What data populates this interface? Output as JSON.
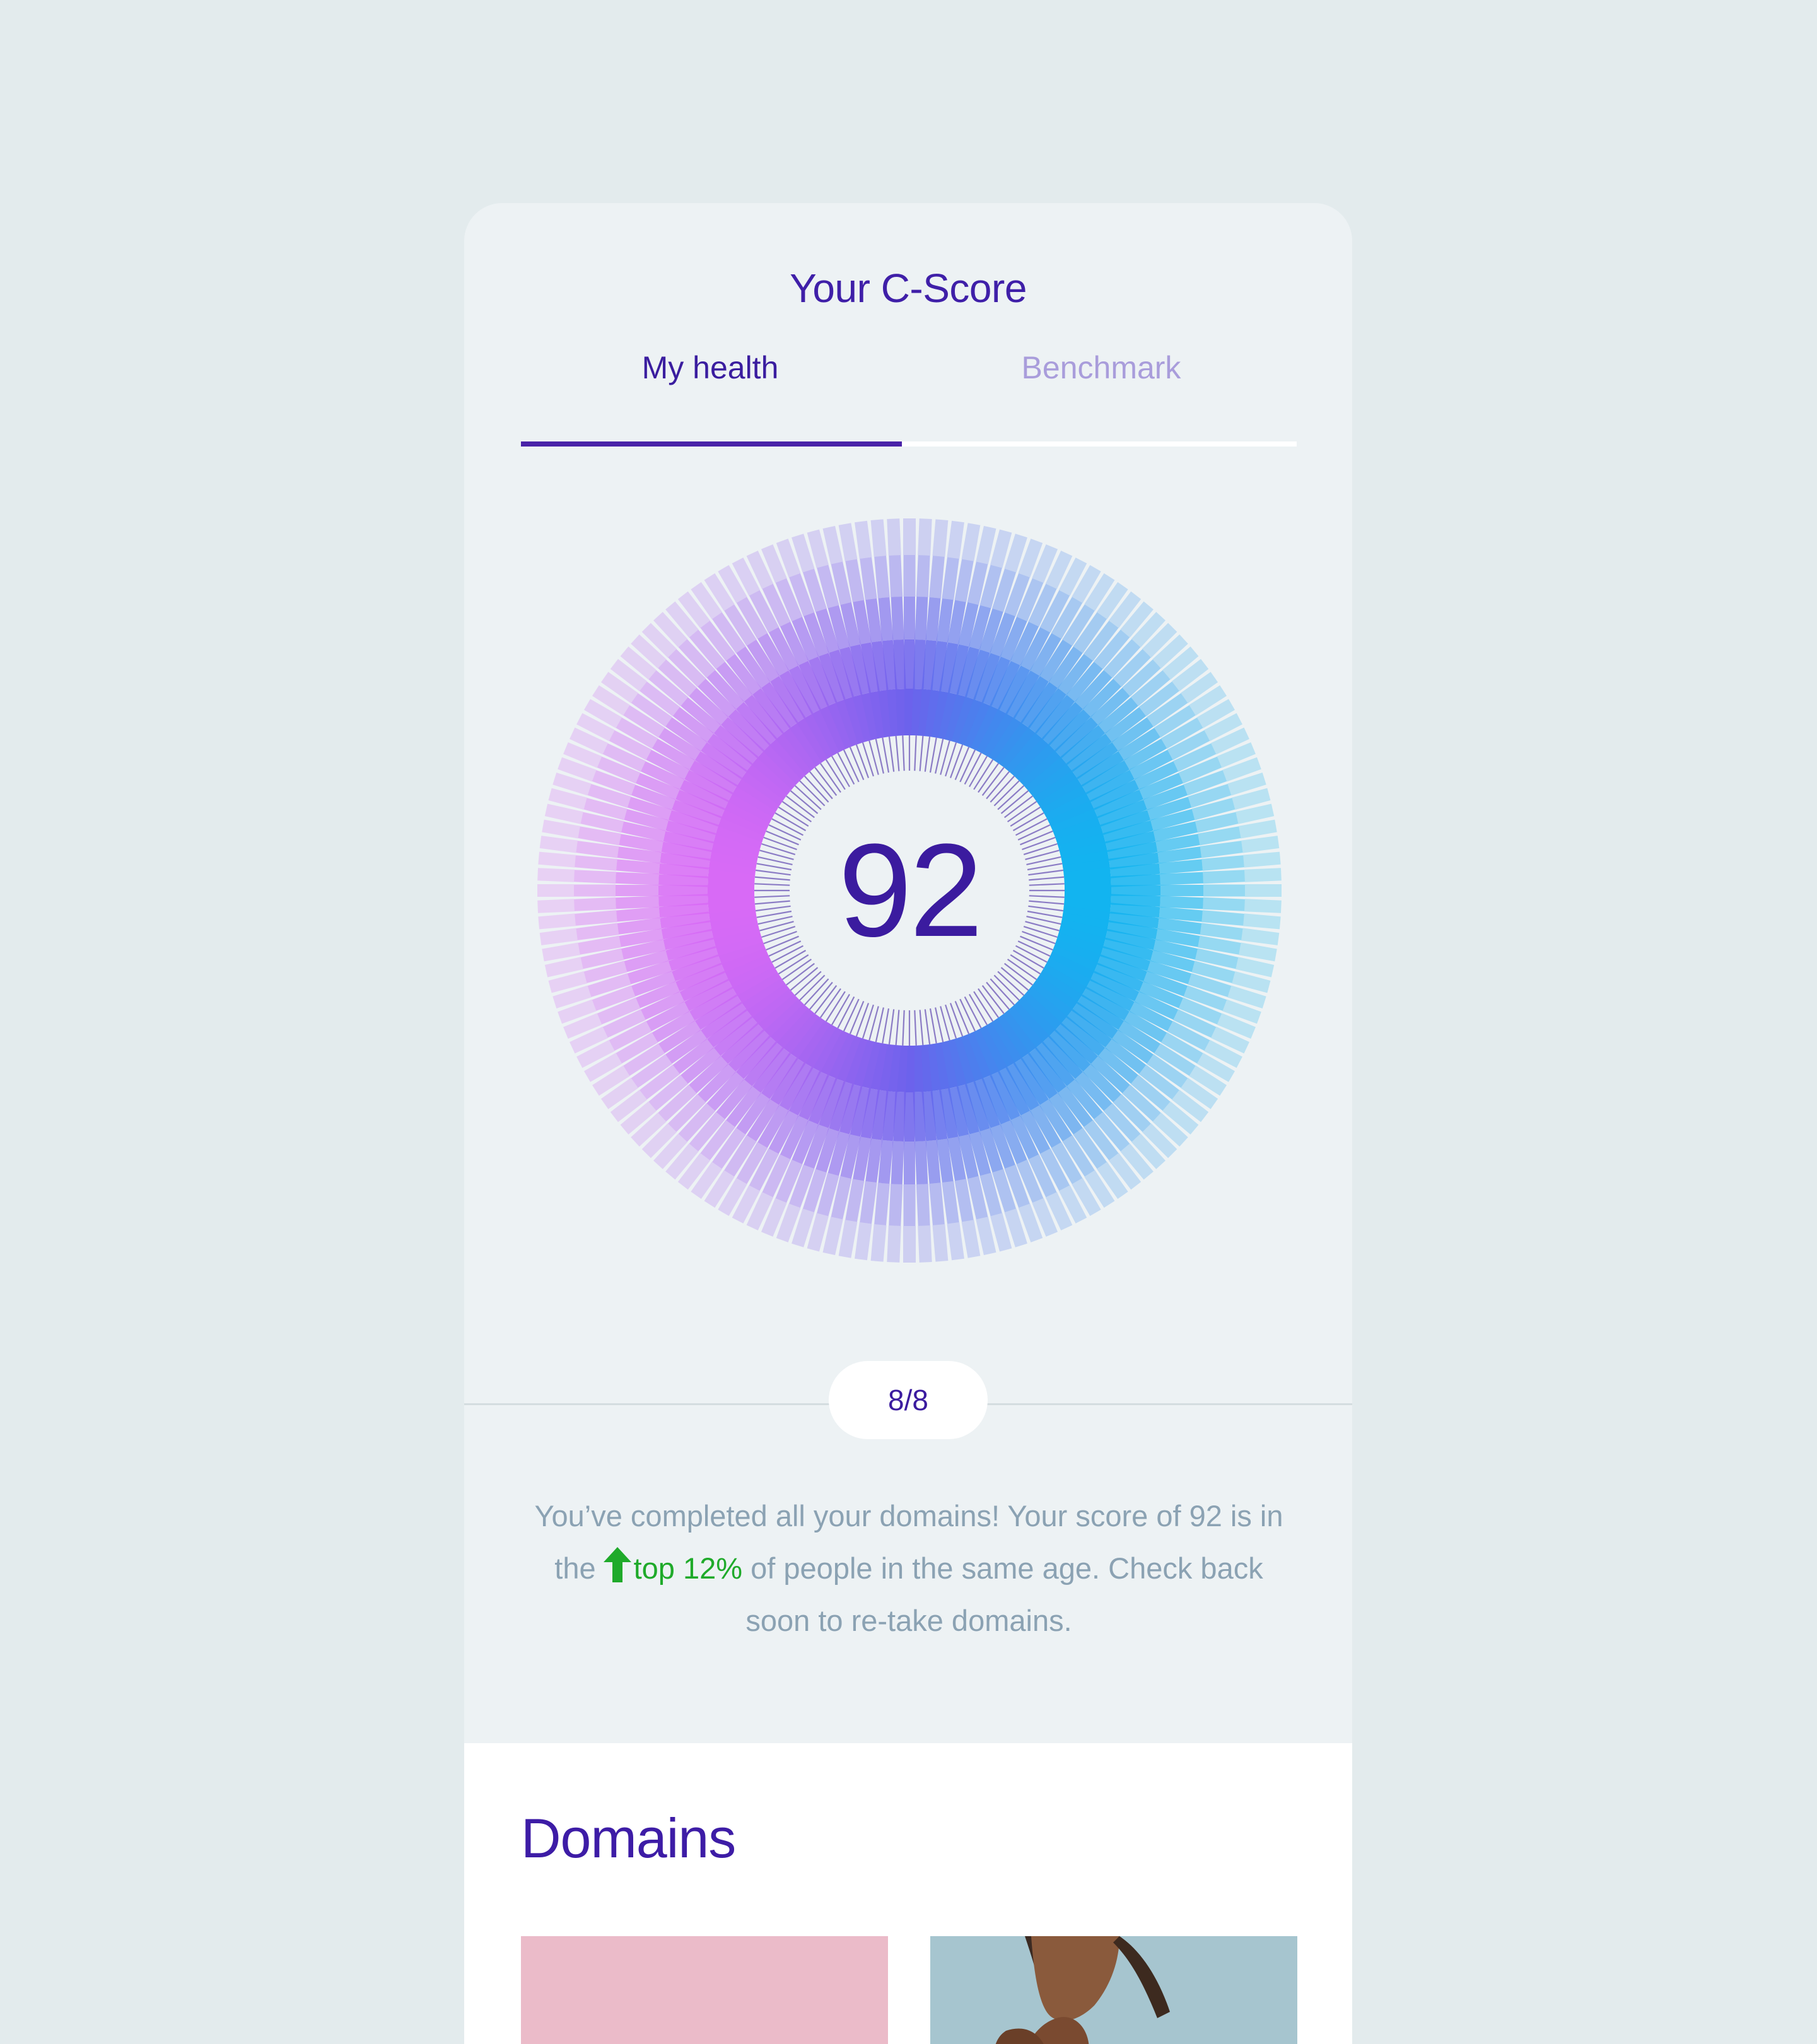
{
  "header": {
    "title": "Your C-Score"
  },
  "tabs": [
    {
      "label": "My health",
      "active": true
    },
    {
      "label": "Benchmark",
      "active": false
    }
  ],
  "score": {
    "value": "92"
  },
  "progress": {
    "label": "8/8",
    "completed": 8,
    "total": 8
  },
  "summary": {
    "part1": "You’ve completed all your domains! Your score of 92 is in the",
    "highlight": "top 12%",
    "part2": "of people in the same age. Check back soon to re-take domains.",
    "highlight_icon": "arrow-up-icon"
  },
  "domains": {
    "title": "Domains"
  },
  "colors": {
    "brand": "#3b1b9f",
    "highlight": "#1faa2a",
    "gauge_left": "#e879f9",
    "gauge_right": "#06b6d4",
    "card_pink": "#ebbbc9"
  }
}
